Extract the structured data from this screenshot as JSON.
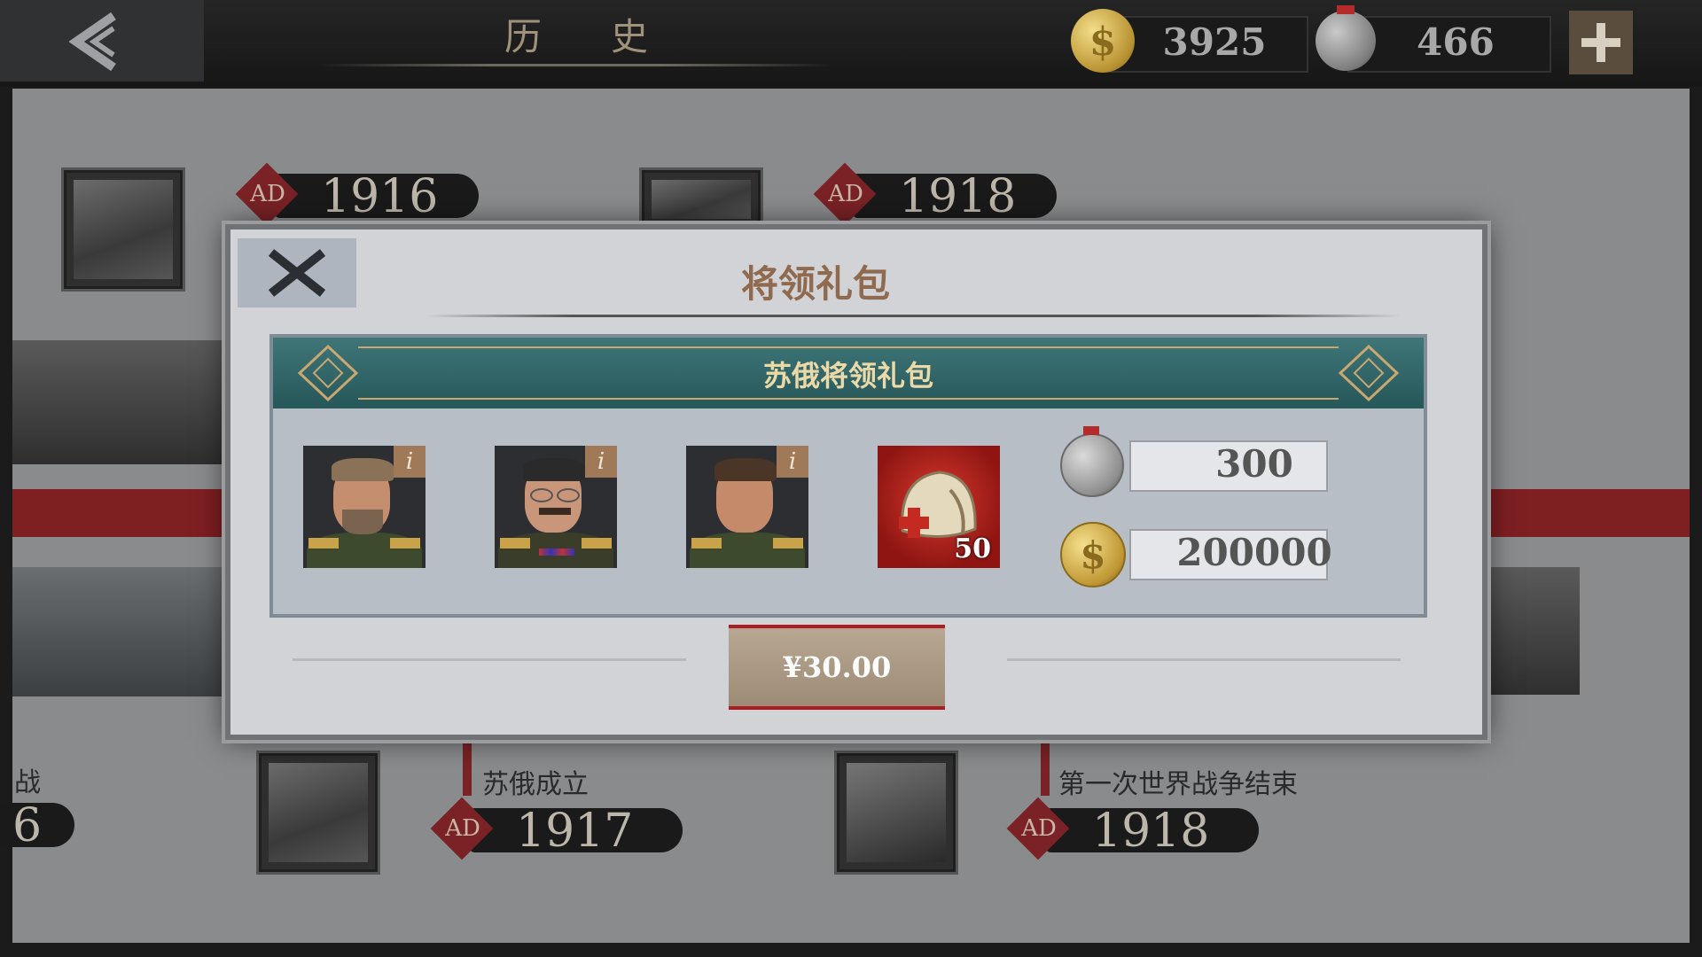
{
  "header": {
    "title": "历史",
    "gold_amount": "3925",
    "medal_amount": "466"
  },
  "timeline": {
    "top_tags": [
      {
        "ad": "AD",
        "year": "1916"
      },
      {
        "ad": "AD",
        "year": "1918"
      }
    ],
    "bottom_events": [
      {
        "label": "战",
        "ad": "",
        "year": "6"
      },
      {
        "label": "苏俄成立",
        "ad": "AD",
        "year": "1917"
      },
      {
        "label": "第一次世界战争结束",
        "ad": "AD",
        "year": "1918"
      }
    ]
  },
  "modal": {
    "title": "将领礼包",
    "pack_name": "苏俄将领礼包",
    "items": [
      {
        "type": "general",
        "info": "i"
      },
      {
        "type": "general",
        "info": "i"
      },
      {
        "type": "general",
        "info": "i"
      },
      {
        "type": "medic-kit",
        "count": "50"
      }
    ],
    "resources": {
      "medals": "300",
      "gold": "200000"
    },
    "price": "¥30.00"
  },
  "colors": {
    "accent_red": "#7e1f22",
    "header_teal": "#2e6365",
    "title_brown": "#8f6a4f"
  }
}
